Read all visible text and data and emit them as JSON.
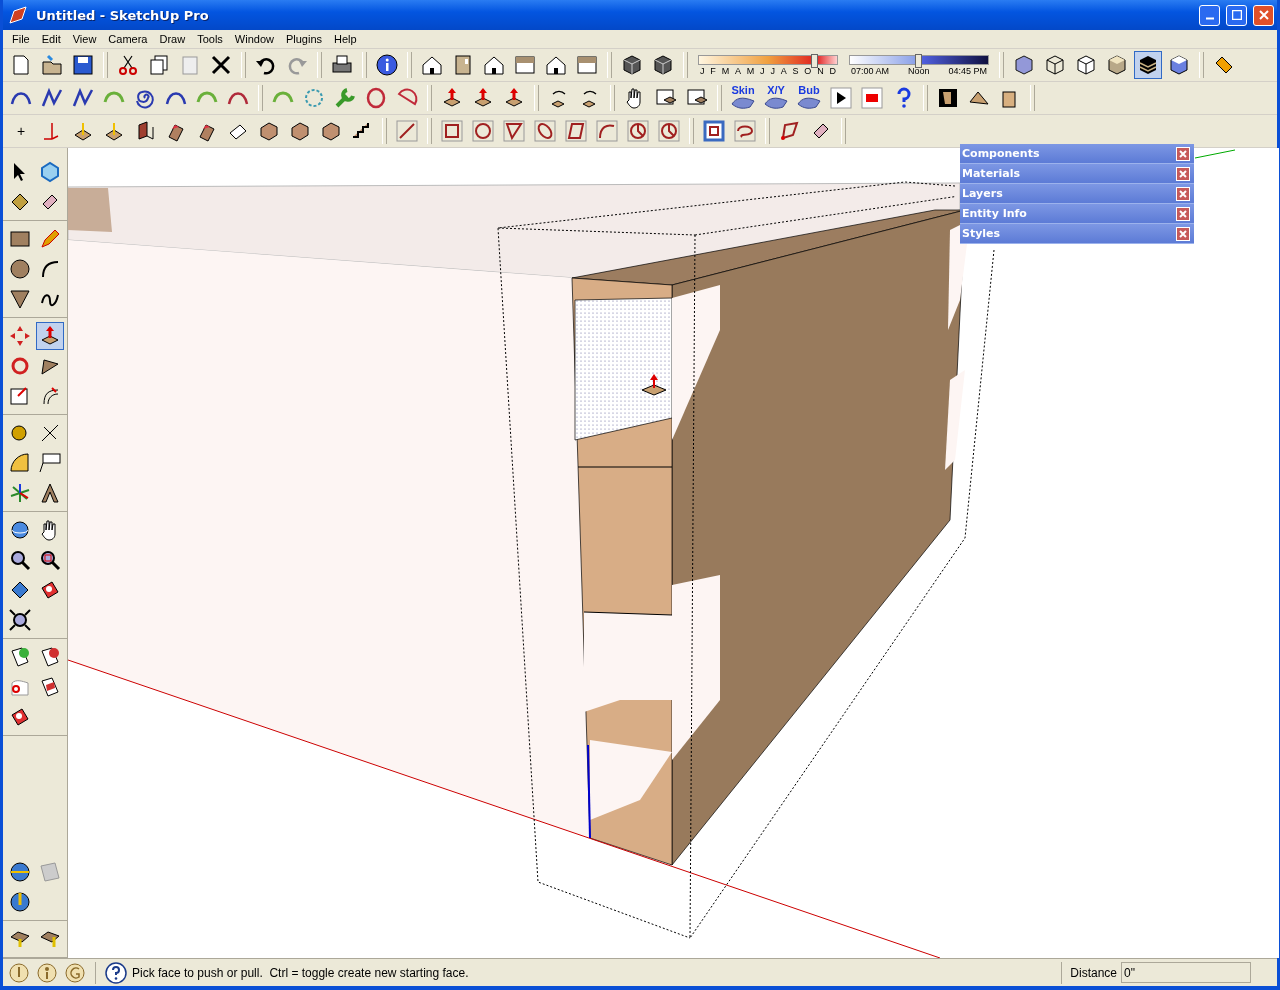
{
  "window": {
    "title": "Untitled - SketchUp Pro"
  },
  "menu": [
    {
      "label": "File"
    },
    {
      "label": "Edit"
    },
    {
      "label": "View"
    },
    {
      "label": "Camera"
    },
    {
      "label": "Draw"
    },
    {
      "label": "Tools"
    },
    {
      "label": "Window"
    },
    {
      "label": "Plugins"
    },
    {
      "label": "Help"
    }
  ],
  "date_slider": {
    "level": 0.83,
    "labels": [
      "J",
      "F",
      "M",
      "A",
      "M",
      "J",
      "J",
      "A",
      "S",
      "O",
      "N",
      "D"
    ]
  },
  "time_slider": {
    "level": 0.49,
    "labels": [
      "07:00 AM",
      "Noon",
      "04:45 PM"
    ]
  },
  "face_styles": [
    {
      "selected": false
    },
    {
      "selected": false
    },
    {
      "selected": false
    },
    {
      "selected": false
    },
    {
      "selected": true
    },
    {
      "selected": false
    }
  ],
  "sandbox_buttons": [
    {
      "label": "Skin"
    },
    {
      "label": "X/Y"
    },
    {
      "label": "Bub"
    }
  ],
  "construction_toolbar": {
    "point_label": "+"
  },
  "tray": [
    {
      "title": "Components"
    },
    {
      "title": "Materials"
    },
    {
      "title": "Layers"
    },
    {
      "title": "Entity Info"
    },
    {
      "title": "Styles"
    }
  ],
  "status_bar": {
    "hint": "Pick face to push or pull.  Ctrl = toggle create new starting face.",
    "measure_label": "Distance",
    "measure_value": "0\""
  }
}
